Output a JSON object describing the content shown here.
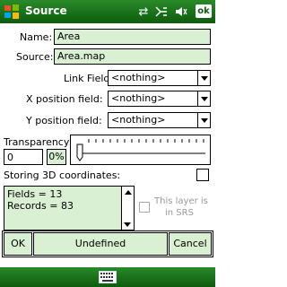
{
  "titlebar": {
    "title": "Source",
    "ok_label": "ok",
    "icons": [
      "windows-logo-icon",
      "connectivity-icon",
      "signal-icon",
      "volume-icon"
    ]
  },
  "form": {
    "name_label": "Name:",
    "name_value": "Area",
    "source_label": "Source:",
    "source_value": "Area.map",
    "link_label": "Link Field:",
    "link_value": "<nothing>",
    "xpos_label": "X position field:",
    "xpos_value": "<nothing>",
    "ypos_label": "Y position field:",
    "ypos_value": "<nothing>",
    "transparency_label": "Transparency:",
    "transparency_value": "0",
    "transparency_pct": "0%",
    "storing3d_label": "Storing 3D coordinates:",
    "info_lines": [
      "Fields = 13",
      "Records = 83"
    ],
    "srs_label_1": "This layer is",
    "srs_label_2": "in SRS"
  },
  "buttons": {
    "ok": "OK",
    "undefined": "Undefined",
    "cancel": "Cancel"
  },
  "colors": {
    "title_green": "#0d5c0d",
    "field_green": "#d9f0d2"
  }
}
